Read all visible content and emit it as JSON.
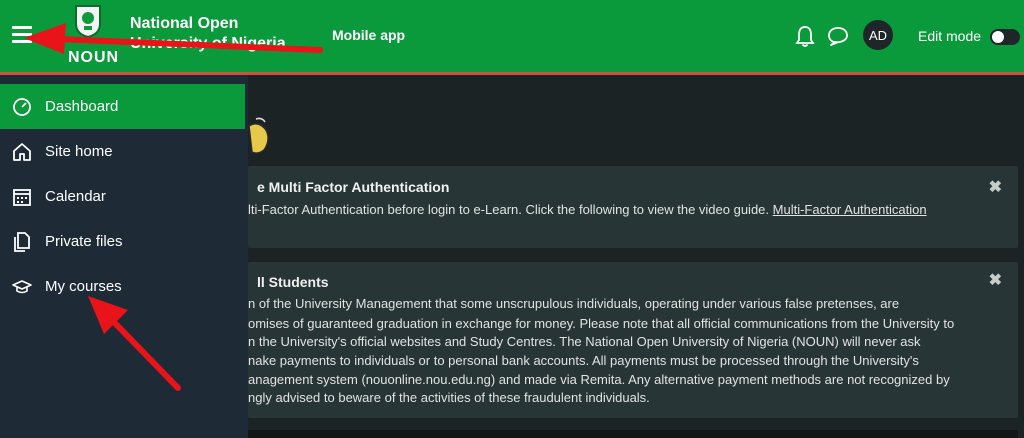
{
  "header": {
    "logo_text": "NOUN",
    "site_name_line1": "National Open",
    "site_name_line2": "University of Nigeria",
    "mobile_app": "Mobile app",
    "avatar": "AD",
    "edit_mode": "Edit mode",
    "edit_mode_on": false,
    "bg_color": "#0a9a3c"
  },
  "sidebar": {
    "items": [
      {
        "label": "Dashboard",
        "icon": "gauge-icon",
        "active": true
      },
      {
        "label": "Site home",
        "icon": "home-icon",
        "active": false
      },
      {
        "label": "Calendar",
        "icon": "calendar-icon",
        "active": false
      },
      {
        "label": "Private files",
        "icon": "files-icon",
        "active": false
      },
      {
        "label": "My courses",
        "icon": "graduation-cap-icon",
        "active": false
      }
    ]
  },
  "notices": [
    {
      "title": "e Multi Factor Authentication",
      "lines": [
        "lti-Factor Authentication before login to e-Learn. Click the following to view the video guide."
      ],
      "link": "Multi-Factor Authentication"
    },
    {
      "title": "ll Students",
      "lines": [
        "n of the University Management that some unscrupulous individuals, operating under various false pretenses, are",
        "omises of guaranteed graduation in exchange for money. Please note that all official communications from the University to",
        "n the University's official websites and Study Centres. The National Open University of Nigeria (NOUN) will never ask",
        "nake payments to individuals or to personal bank accounts. All payments must be processed through the University's",
        "anagement system (nouonline.nou.edu.ng) and made via Remita. Any alternative payment methods are not recognized by",
        "ngly advised to beware of the activities of these fraudulent individuals."
      ]
    }
  ],
  "close_glyph": "✖"
}
